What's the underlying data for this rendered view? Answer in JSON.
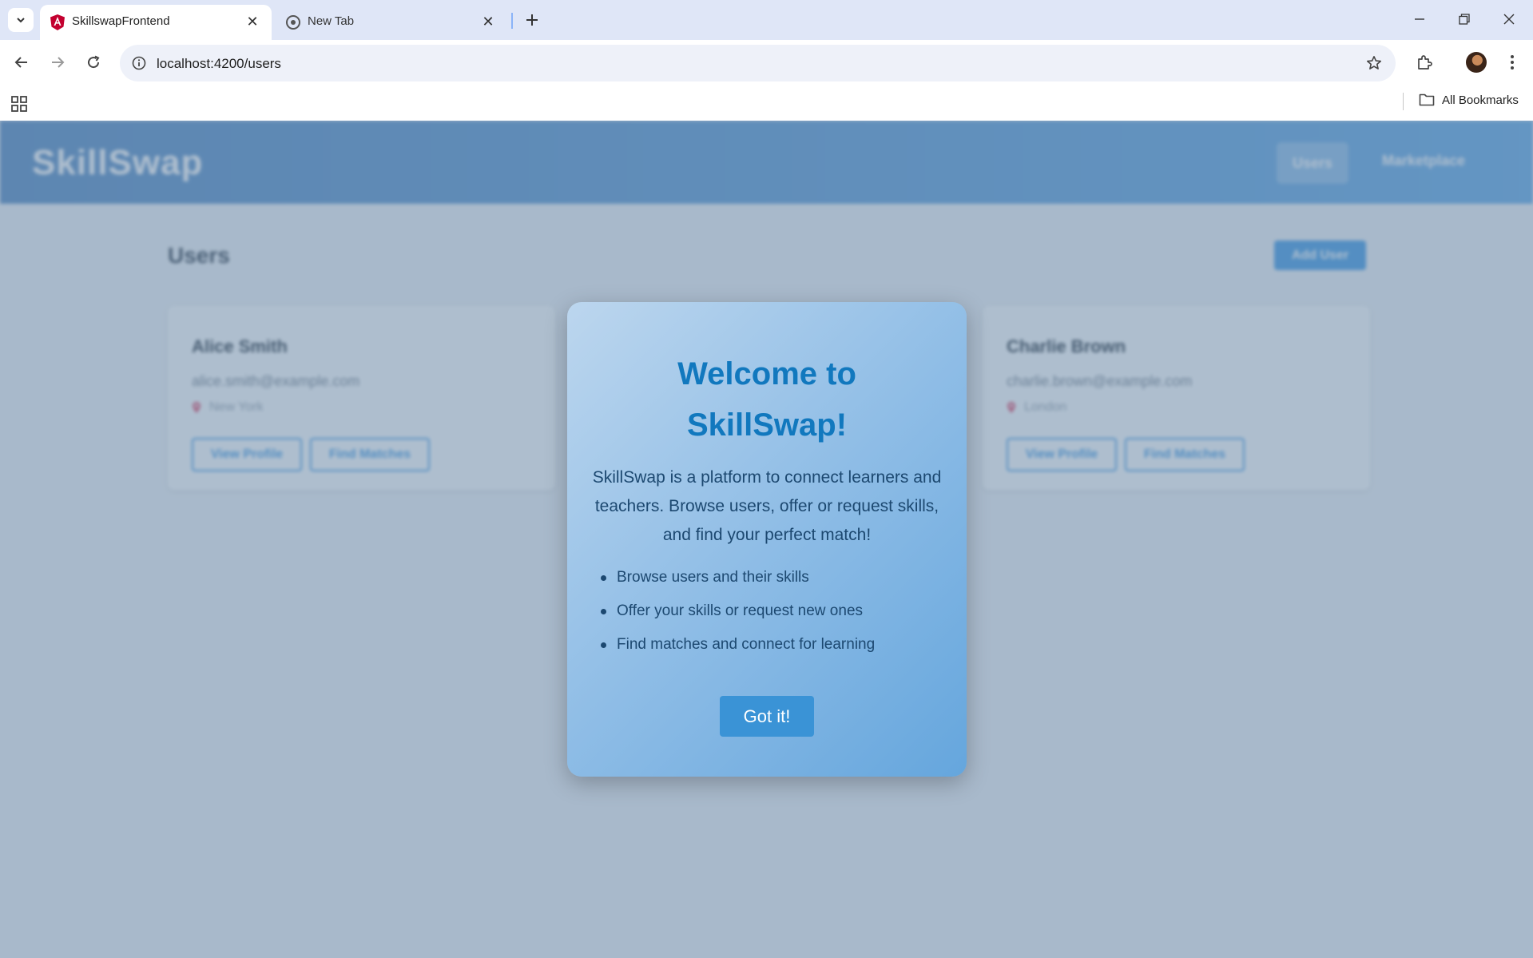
{
  "browser": {
    "tabs": [
      {
        "title": "SkillswapFrontend",
        "active": true,
        "favicon": "angular-icon"
      },
      {
        "title": "New Tab",
        "active": false,
        "favicon": "chrome-icon"
      }
    ],
    "address_bar": {
      "url": "localhost:4200/users"
    },
    "bookmarks_bar": {
      "all_bookmarks_label": "All Bookmarks"
    }
  },
  "app": {
    "brand": "SkillSwap",
    "nav": {
      "users_label": "Users",
      "marketplace_label": "Marketplace"
    },
    "page_title": "Users",
    "add_user_label": "Add User",
    "users": [
      {
        "name": "Alice Smith",
        "email": "alice.smith@example.com",
        "location": "New York",
        "view_label": "View Profile",
        "match_label": "Find Matches"
      },
      {
        "name": "Charlie Brown",
        "email": "charlie.brown@example.com",
        "location": "London",
        "view_label": "View Profile",
        "match_label": "Find Matches"
      }
    ]
  },
  "modal": {
    "title_line1": "Welcome to",
    "title_line2": "SkillSwap!",
    "description": "SkillSwap is a platform to connect learners and teachers. Browse users, offer or request skills, and find your perfect match!",
    "features": [
      "Browse users and their skills",
      "Offer your skills or request new ones",
      "Find matches and connect for learning"
    ],
    "button_label": "Got it!"
  },
  "colors": {
    "header_gradient_start": "#5d8fc5",
    "header_gradient_end": "#6aaee8",
    "accent": "#4a9fe6",
    "modal_title": "#1178be",
    "modal_button": "#3a93d6"
  }
}
